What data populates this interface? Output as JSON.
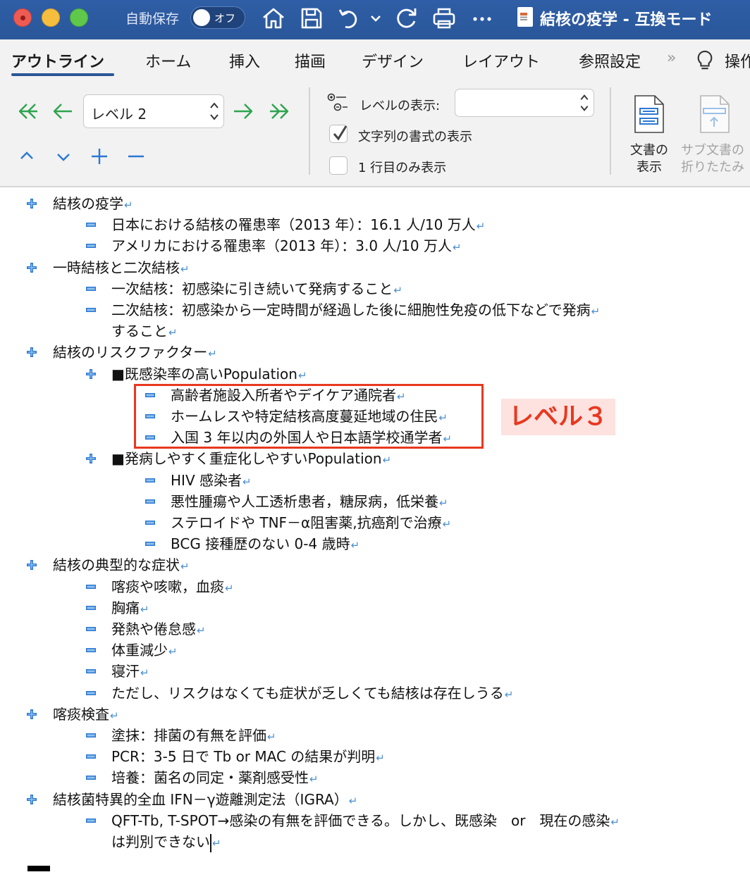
{
  "titlebar": {
    "autosave_label": "自動保存",
    "autosave_state": "オフ",
    "doc_title": "結核の疫学 - 互換モード",
    "icons": [
      "home-icon",
      "save-icon",
      "undo-icon",
      "redo-icon",
      "print-icon",
      "more-icon"
    ]
  },
  "ribbon": {
    "tabs": [
      "アウトライン",
      "ホーム",
      "挿入",
      "描画",
      "デザイン",
      "レイアウト",
      "参照設定",
      "操作"
    ],
    "active_tab": "アウトライン",
    "level_select": "レベル 2",
    "show_level_label": "レベルの表示:",
    "show_level_value": "",
    "show_formatting_label": "文字列の書式の表示",
    "show_formatting_checked": true,
    "first_line_only_label": "1 行目のみ表示",
    "first_line_only_checked": false,
    "show_document_label_1": "文書の",
    "show_document_label_2": "表示",
    "collapse_subdoc_label_1": "サブ文書の",
    "collapse_subdoc_label_2": "折りたたみ",
    "accent_color": "#2b5797",
    "arrow_color": "#2ea44f"
  },
  "outline": [
    {
      "level": 1,
      "marker": "plus",
      "text": "結核の疫学"
    },
    {
      "level": 2,
      "marker": "minus",
      "text": "日本における結核の罹患率（2013 年）：16.1 人/10 万人"
    },
    {
      "level": 2,
      "marker": "minus",
      "text": "アメリカにおける罹患率（2013 年）：3.0 人/10 万人"
    },
    {
      "level": 1,
      "marker": "plus",
      "text": "一時結核と二次結核"
    },
    {
      "level": 2,
      "marker": "minus",
      "text": "一次結核：初感染に引き続いて発病すること"
    },
    {
      "level": 2,
      "marker": "minus",
      "text": "二次結核：初感染から一定時間が経過した後に細胞性免疫の低下などで発病"
    },
    {
      "level": 2,
      "marker": "none",
      "text": "すること"
    },
    {
      "level": 1,
      "marker": "plus",
      "text": "結核のリスクファクター"
    },
    {
      "level": 2,
      "marker": "plus",
      "text": "■既感染率の高いPopulation"
    },
    {
      "level": 3,
      "marker": "minus",
      "text": "高齢者施設入所者やデイケア通院者"
    },
    {
      "level": 3,
      "marker": "minus",
      "text": "ホームレスや特定結核高度蔓延地域の住民"
    },
    {
      "level": 3,
      "marker": "minus",
      "text": "入国 3 年以内の外国人や日本語学校通学者"
    },
    {
      "level": 2,
      "marker": "plus",
      "text": "■発病しやすく重症化しやすいPopulation"
    },
    {
      "level": 3,
      "marker": "minus",
      "text": "HIV 感染者"
    },
    {
      "level": 3,
      "marker": "minus",
      "text": "悪性腫瘍や人工透析患者，糖尿病，低栄養"
    },
    {
      "level": 3,
      "marker": "minus",
      "text": "ステロイドや TNF－α阻害薬,抗癌剤で治療"
    },
    {
      "level": 3,
      "marker": "minus",
      "text": "BCG 接種歴のない 0-4 歳時"
    },
    {
      "level": 1,
      "marker": "plus",
      "text": "結核の典型的な症状"
    },
    {
      "level": 2,
      "marker": "minus",
      "text": "喀痰や咳嗽，血痰"
    },
    {
      "level": 2,
      "marker": "minus",
      "text": "胸痛"
    },
    {
      "level": 2,
      "marker": "minus",
      "text": "発熱や倦怠感"
    },
    {
      "level": 2,
      "marker": "minus",
      "text": "体重減少"
    },
    {
      "level": 2,
      "marker": "minus",
      "text": "寝汗"
    },
    {
      "level": 2,
      "marker": "minus",
      "text": "ただし、リスクはなくても症状が乏しくても結核は存在しうる"
    },
    {
      "level": 1,
      "marker": "plus",
      "text": "喀痰検査"
    },
    {
      "level": 2,
      "marker": "minus",
      "text": "塗抹：排菌の有無を評価"
    },
    {
      "level": 2,
      "marker": "minus",
      "text": "PCR：3-5 日で Tb or MAC の結果が判明"
    },
    {
      "level": 2,
      "marker": "minus",
      "text": "培養：菌名の同定・薬剤感受性"
    },
    {
      "level": 1,
      "marker": "plus",
      "text": "結核菌特異的全血 IFN－γ遊離測定法（IGRA）"
    },
    {
      "level": 2,
      "marker": "minus",
      "text": "QFT-Tb, T-SPOT→感染の有無を評価できる。しかし、既感染　or　現在の感染"
    },
    {
      "level": 2,
      "marker": "none",
      "text": "は判別できない"
    }
  ],
  "annotation": {
    "label": "レベル３",
    "color": "#e8381f"
  }
}
